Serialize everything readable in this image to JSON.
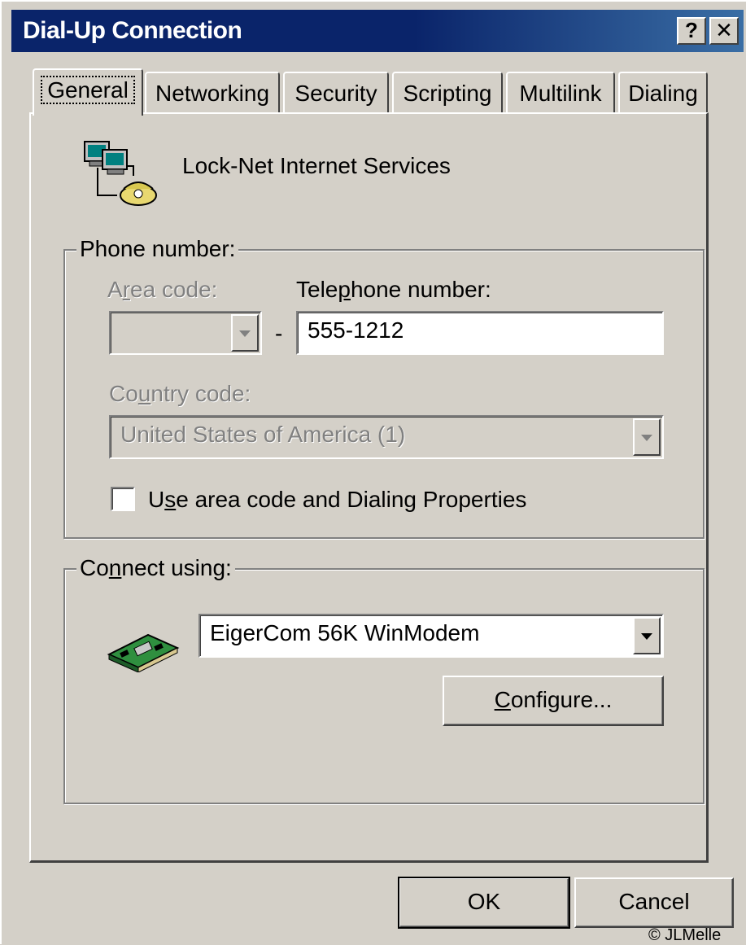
{
  "window": {
    "title": "Dial-Up Connection",
    "help_button": "?",
    "close_button": "✕"
  },
  "tabs": [
    {
      "label": "General",
      "active": true
    },
    {
      "label": "Networking",
      "active": false
    },
    {
      "label": "Security",
      "active": false
    },
    {
      "label": "Scripting",
      "active": false
    },
    {
      "label": "Multilink",
      "active": false
    },
    {
      "label": "Dialing",
      "active": false
    }
  ],
  "general": {
    "connection_icon": "dial-up-computer-phone-icon",
    "connection_name": "Lock-Net Internet Services"
  },
  "phone_number": {
    "group_label": "Phone number:",
    "area_code_label_pre": "A",
    "area_code_label_accel": "r",
    "area_code_label_post": "ea code:",
    "area_code_value": "",
    "separator": "-",
    "telephone_label_pre": "Tele",
    "telephone_label_accel": "p",
    "telephone_label_post": "hone number:",
    "telephone_value": "555-1212",
    "country_label_pre": "Co",
    "country_label_accel": "u",
    "country_label_post": "ntry code:",
    "country_value": "United States of America (1)",
    "use_dialing_pre": "U",
    "use_dialing_accel": "s",
    "use_dialing_post": "e area code and Dialing Properties",
    "use_dialing_checked": false
  },
  "connect_using": {
    "group_label_pre": "Co",
    "group_label_accel": "n",
    "group_label_post": "nect using:",
    "modem_icon": "modem-card-icon",
    "device_value": "EigerCom 56K WinModem",
    "configure_pre": "",
    "configure_accel": "C",
    "configure_post": "onfigure..."
  },
  "footer": {
    "ok_label": "OK",
    "cancel_label": "Cancel",
    "copyright": "© JLMelle"
  },
  "colors": {
    "face": "#d4d0c8",
    "titlebar": "#0a246a",
    "disabled_text": "#808080"
  }
}
